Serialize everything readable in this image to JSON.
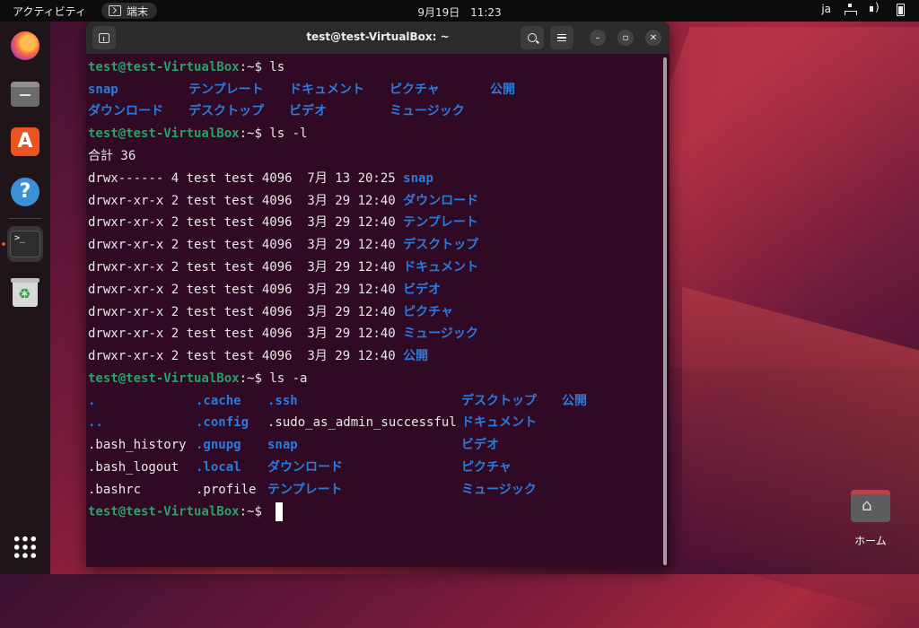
{
  "topbar": {
    "activities": "アクティビティ",
    "app_name": "端末",
    "date": "9月19日",
    "time": "11:23",
    "input_method": "ja"
  },
  "dock": {
    "items": [
      {
        "name": "firefox-icon"
      },
      {
        "name": "files-icon"
      },
      {
        "name": "app-center-icon"
      },
      {
        "name": "help-icon"
      },
      {
        "name": "terminal-icon",
        "label": ">_"
      },
      {
        "name": "trash-icon"
      }
    ]
  },
  "terminal": {
    "title": "test@test-VirtualBox: ~",
    "prompt_user": "test@test-VirtualBox",
    "prompt_path": ":~",
    "prompt_sign": "$ ",
    "commands": [
      "ls",
      "ls -l",
      "ls -a"
    ],
    "ls_output": {
      "row1": [
        "snap",
        "テンプレート",
        "ドキュメント",
        "ピクチャ",
        "公開"
      ],
      "row2": [
        "ダウンロード",
        "デスクトップ",
        "ビデオ",
        "ミュージック"
      ]
    },
    "ls_l": {
      "total": "合計 36",
      "rows": [
        {
          "perm": "drwx------ 4 test test 4096  7月 13 20:25 ",
          "name": "snap"
        },
        {
          "perm": "drwxr-xr-x 2 test test 4096  3月 29 12:40 ",
          "name": "ダウンロード"
        },
        {
          "perm": "drwxr-xr-x 2 test test 4096  3月 29 12:40 ",
          "name": "テンプレート"
        },
        {
          "perm": "drwxr-xr-x 2 test test 4096  3月 29 12:40 ",
          "name": "デスクトップ"
        },
        {
          "perm": "drwxr-xr-x 2 test test 4096  3月 29 12:40 ",
          "name": "ドキュメント"
        },
        {
          "perm": "drwxr-xr-x 2 test test 4096  3月 29 12:40 ",
          "name": "ビデオ"
        },
        {
          "perm": "drwxr-xr-x 2 test test 4096  3月 29 12:40 ",
          "name": "ピクチャ"
        },
        {
          "perm": "drwxr-xr-x 2 test test 4096  3月 29 12:40 ",
          "name": "ミュージック"
        },
        {
          "perm": "drwxr-xr-x 2 test test 4096  3月 29 12:40 ",
          "name": "公開"
        }
      ]
    },
    "ls_a": {
      "col1": [
        ".",
        "..",
        ".bash_history",
        ".bash_logout",
        ".bashrc"
      ],
      "col2": [
        ".cache",
        ".config",
        ".gnupg",
        ".local",
        ".profile"
      ],
      "col3": [
        ".ssh",
        ".sudo_as_admin_successful",
        "snap",
        "ダウンロード",
        "テンプレート"
      ],
      "col4": [
        "デスクトップ",
        "ドキュメント",
        "ビデオ",
        "ピクチャ",
        "ミュージック"
      ],
      "col5": [
        "公開"
      ]
    }
  },
  "desktop": {
    "home_label": "ホーム"
  }
}
